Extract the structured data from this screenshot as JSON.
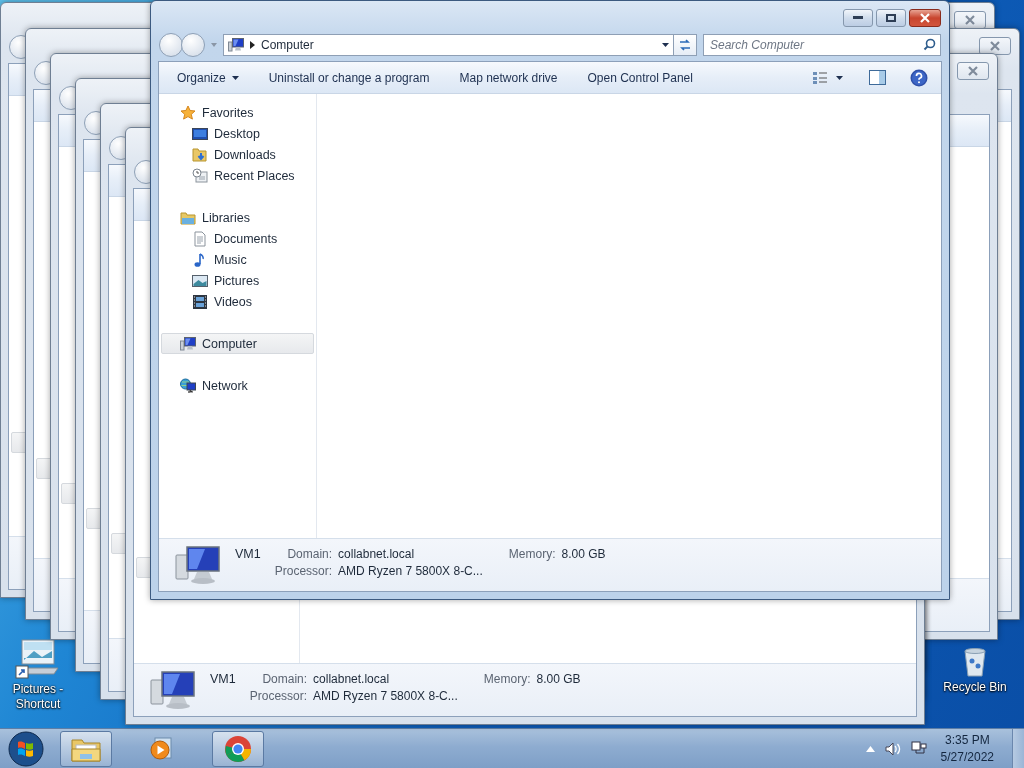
{
  "main_window": {
    "address": {
      "location": "Computer"
    },
    "search": {
      "placeholder": "Search Computer"
    },
    "toolbar": [
      {
        "label": "Organize",
        "kind": "menu"
      },
      {
        "label": "Uninstall or change a program",
        "kind": "command"
      },
      {
        "label": "Map network drive",
        "kind": "command"
      },
      {
        "label": "Open Control Panel",
        "kind": "command"
      }
    ],
    "navigation": [
      {
        "label": "Favorites",
        "selected": false,
        "children": [
          {
            "label": "Desktop",
            "selected": false
          },
          {
            "label": "Downloads",
            "selected": false
          },
          {
            "label": "Recent Places",
            "selected": false
          }
        ]
      },
      {
        "label": "Libraries",
        "selected": false,
        "children": [
          {
            "label": "Documents",
            "selected": false
          },
          {
            "label": "Music",
            "selected": false
          },
          {
            "label": "Pictures",
            "selected": false
          },
          {
            "label": "Videos",
            "selected": false
          }
        ]
      },
      {
        "label": "Computer",
        "selected": true
      },
      {
        "label": "Network",
        "selected": false
      }
    ],
    "details": {
      "name": "VM1",
      "fields": [
        {
          "label": "Domain:",
          "value": "collabnet.local"
        },
        {
          "label": "Memory:",
          "value": "8.00 GB"
        },
        {
          "label": "Processor:",
          "value": "AMD Ryzen 7 5800X 8-C..."
        }
      ]
    }
  },
  "back_window": {
    "details": {
      "name": "VM1",
      "fields": [
        {
          "label": "Domain:",
          "value": "collabnet.local"
        },
        {
          "label": "Memory:",
          "value": "8.00 GB"
        },
        {
          "label": "Processor:",
          "value": "AMD Ryzen 7 5800X 8-C..."
        }
      ]
    }
  },
  "desktop_icons": [
    {
      "label": "Pictures - Shortcut"
    },
    {
      "label": "Recycle Bin"
    }
  ],
  "taskbar": {
    "apps": [
      {
        "open": true
      },
      {
        "open": false
      },
      {
        "open": true
      }
    ],
    "clock": {
      "time": "3:35 PM",
      "date": "5/27/2022"
    }
  }
}
